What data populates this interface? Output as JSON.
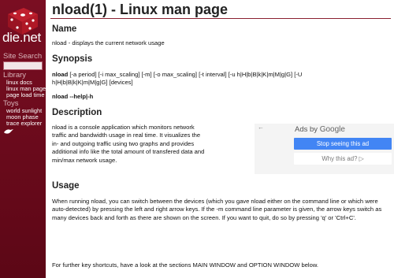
{
  "sidebar": {
    "logo_text": "die.net",
    "search_heading": "Site Search",
    "library_heading": "Library",
    "library_links": [
      "linux docs",
      "linux man pages",
      "page load time"
    ],
    "toys_heading": "Toys",
    "toys_links": [
      "world sunlight",
      "moon phase",
      "trace explorer"
    ]
  },
  "page": {
    "title": "nload(1) - Linux man page",
    "name_heading": "Name",
    "name_text": "nload - displays the current network usage",
    "synopsis_heading": "Synopsis",
    "synopsis_line1": "[-a period] [-i max_scaling] [-m] [-o max_scaling] [-t interval] [-u h|H|b|B|k|K|m|M|g|G] [-U",
    "synopsis_line2": "h|H|b|B|k|K|m|M|g|G] [devices]",
    "synopsis_help": "nload --help|-h",
    "description_heading": "Description",
    "description_text": "nload is a console application which monitors network traffic and bandwidth usage in real time. It visualizes the in- and outgoing traffic using two graphs and provides additional info like the total amount of transfered data and min/max network usage.",
    "usage_heading": "Usage",
    "usage_text": "When running nload, you can switch between the devices (which you gave nload either on the command line or which were auto-detected) by pressing the left and right arrow keys. If the -m command line parameter is given, the arrow keys switch as many devices back and forth as there are shown on the screen. If you want to quit, do so by pressing 'q' or 'Ctrl+C'.",
    "shortcuts_text": "For further key shortcuts, have a look at the sections MAIN WINDOW and OPTION WINDOW below."
  },
  "ad": {
    "back_glyph": "←",
    "label_prefix": "Ads by",
    "label_brand": "Google",
    "stop_label": "Stop seeing this ad",
    "why_label": "Why this ad? ▷"
  },
  "colors": {
    "sidebar_bg": "#6e0a1c",
    "ad_button_blue": "#4285f4"
  }
}
